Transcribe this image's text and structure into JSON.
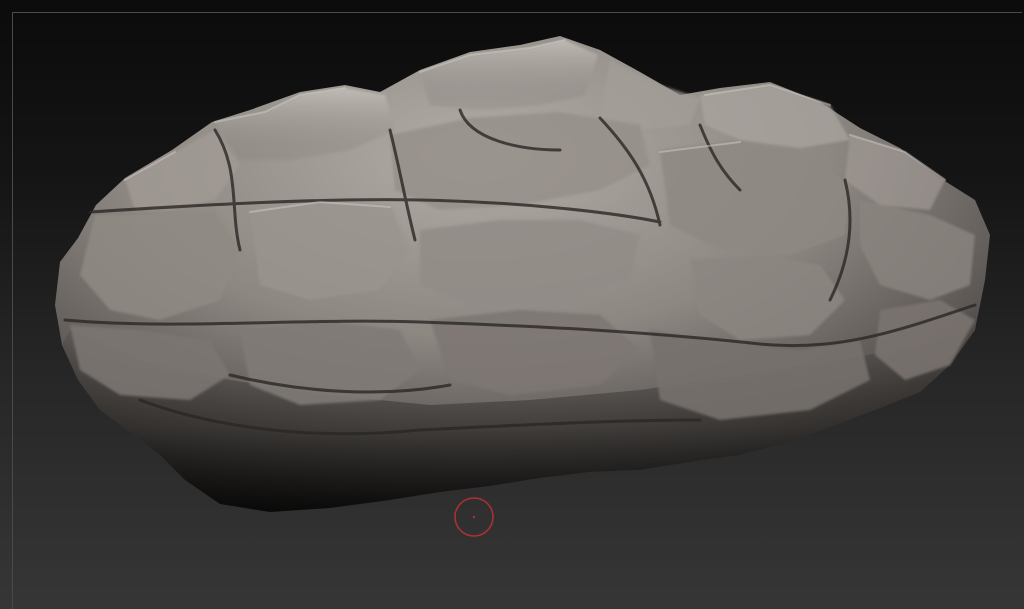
{
  "viewport": {
    "model": "rock-sculpt",
    "brush_cursor_color": "#b03030",
    "background_top": "#0b0b0b",
    "background_bottom": "#363636",
    "rock_base_color": "#8c8580"
  }
}
